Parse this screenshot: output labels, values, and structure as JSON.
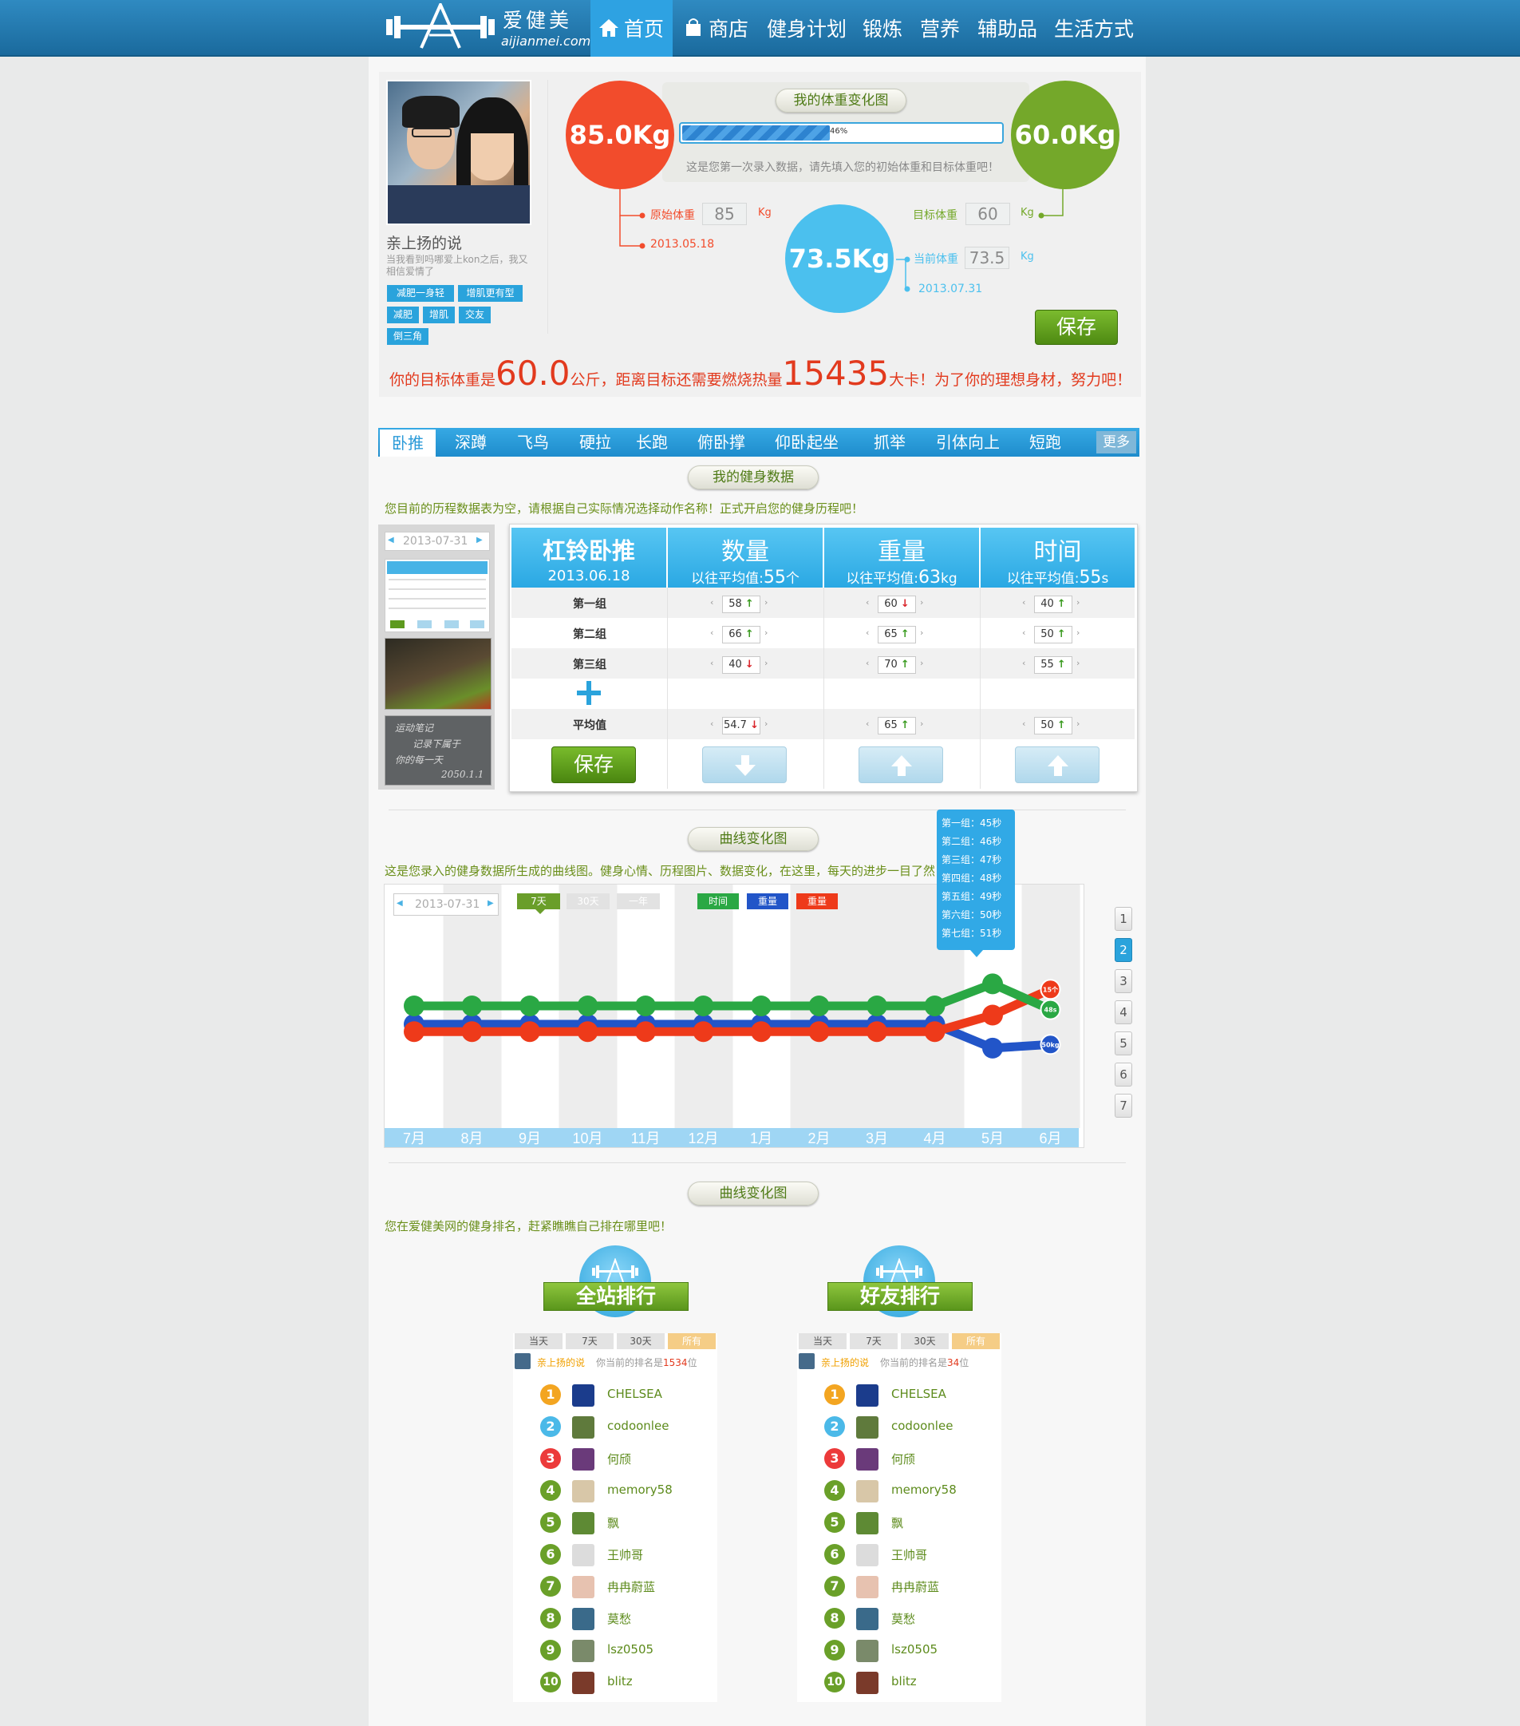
{
  "header": {
    "logo_cn": "爱健美",
    "logo_en": "aijianmei.com",
    "nav": [
      "首页",
      "商店",
      "健身计划",
      "锻炼",
      "营养",
      "辅助品",
      "生活方式"
    ],
    "active_nav": "首页"
  },
  "profile": {
    "name": "亲上扬的说",
    "bio": "当我看到吗哪爱上kon之后，我又相信爱情了",
    "tags": [
      "减肥一身轻",
      "增肌更有型",
      "减肥",
      "增肌",
      "交友",
      "倒三角"
    ]
  },
  "weight": {
    "chart_title": "我的体重变化图",
    "initial_circle": "85.0Kg",
    "target_circle": "60.0Kg",
    "current_circle": "73.5Kg",
    "progress_label": "46%",
    "progress": 0.46,
    "hint": "这是您第一次录入数据，请先填入您的初始体重和目标体重吧！",
    "initial_label": "原始体重",
    "initial_value": "85",
    "initial_date": "2013.05.18",
    "target_label": "目标体重",
    "target_value": "60",
    "current_label": "当前体重",
    "current_value": "73.5",
    "current_date": "2013.07.31",
    "unit": "Kg",
    "save_label": "保存",
    "colors": {
      "initial": "#f24c2c",
      "target": "#74a82a",
      "current": "#4bc0ee"
    }
  },
  "goal_line": {
    "p1": "你的目标体重是",
    "target": "60.0",
    "p2": "公斤，距离目标还需要燃烧热量",
    "kcal": "15435",
    "p3": "大卡！为了你的理想身材，努力吧！"
  },
  "exercise_tabs": [
    "卧推",
    "深蹲",
    "飞鸟",
    "硬拉",
    "长跑",
    "俯卧撑",
    "仰卧起坐",
    "抓举",
    "引体向上",
    "短跑"
  ],
  "exercise_more": "更多",
  "fitness": {
    "section_title": "我的健身数据",
    "hint": "您目前的历程数据表为空，请根据自己实际情况选择动作名称！正式开启您的健身历程吧！",
    "side_date": "2013-07-31",
    "note_lines": [
      "运动笔记",
      "记录下属于",
      "你的每一天"
    ],
    "note_date": "2050.1.1",
    "exercise_name": "杠铃卧推",
    "exercise_date": "2013.06.18",
    "columns": [
      {
        "title": "数量",
        "avg_label": "以往平均值:",
        "avg": "55",
        "unit": "个"
      },
      {
        "title": "重量",
        "avg_label": "以往平均值:",
        "avg": "63",
        "unit": "kg"
      },
      {
        "title": "时间",
        "avg_label": "以往平均值:",
        "avg": "55",
        "unit": "s"
      }
    ],
    "rows": [
      {
        "label": "第一组",
        "values": [
          [
            "58",
            "up"
          ],
          [
            "60",
            "down"
          ],
          [
            "40",
            "up"
          ]
        ]
      },
      {
        "label": "第二组",
        "values": [
          [
            "66",
            "up"
          ],
          [
            "65",
            "up"
          ],
          [
            "50",
            "up"
          ]
        ]
      },
      {
        "label": "第三组",
        "values": [
          [
            "40",
            "down"
          ],
          [
            "70",
            "up"
          ],
          [
            "55",
            "up"
          ]
        ]
      },
      {
        "label": "平均值",
        "values": [
          [
            "54.7",
            "down"
          ],
          [
            "65",
            "up"
          ],
          [
            "50",
            "up"
          ]
        ]
      }
    ],
    "save_label": "保存"
  },
  "curve": {
    "section_title": "曲线变化图",
    "hint": "这是您录入的健身数据所生成的曲线图。健身心情、历程图片、数据变化，在这里，每天的进步一目了然！",
    "date": "2013-07-31",
    "ranges": [
      "7天",
      "30天",
      "一年"
    ],
    "active_range": "7天",
    "legend": [
      {
        "label": "时间",
        "color": "#2aa844"
      },
      {
        "label": "重量",
        "color": "#2255c8"
      },
      {
        "label": "重量",
        "color": "#ee3a1a"
      }
    ],
    "tooltip": [
      "第一组：45秒",
      "第二组：46秒",
      "第三组：47秒",
      "第四组：48秒",
      "第五组：49秒",
      "第六组：50秒",
      "第七组：51秒"
    ],
    "end_labels": [
      "15个",
      "48s",
      "50kg"
    ],
    "pages": [
      "1",
      "2",
      "3",
      "4",
      "5",
      "6",
      "7"
    ],
    "active_page": "2"
  },
  "chart_data": {
    "type": "line",
    "categories": [
      "7月",
      "8月",
      "9月",
      "10月",
      "11月",
      "12月",
      "1月",
      "2月",
      "3月",
      "4月",
      "5月",
      "6月"
    ],
    "series": [
      {
        "color": "#2aa844",
        "values": [
          10,
          10,
          10,
          10,
          10,
          10,
          10,
          10,
          10,
          10,
          22,
          8
        ]
      },
      {
        "color": "#2255c8",
        "values": [
          0,
          0,
          0,
          0,
          0,
          0,
          0,
          0,
          0,
          0,
          -13,
          -11
        ]
      },
      {
        "color": "#ee3a1a",
        "values": [
          -4,
          -4,
          -4,
          -4,
          -4,
          -4,
          -4,
          -4,
          -4,
          -4,
          5,
          19
        ]
      }
    ],
    "grid": "alternating columns"
  },
  "ranking": {
    "section_title": "曲线变化图",
    "hint": "您在爱健美网的健身排名，赶紧瞧瞧自己排在哪里吧！",
    "boards": [
      {
        "title": "全站排行",
        "my_rank": "1534"
      },
      {
        "title": "好友排行",
        "my_rank": "34"
      }
    ],
    "tabs": [
      "当天",
      "7天",
      "30天",
      "所有"
    ],
    "active_tab": "所有",
    "me": "亲上扬的说",
    "rank_prefix": "你当前的排名是",
    "rank_suffix": "位",
    "entries": [
      {
        "n": "1",
        "name": "CHELSEA"
      },
      {
        "n": "2",
        "name": "codoonlee"
      },
      {
        "n": "3",
        "name": "何颀"
      },
      {
        "n": "4",
        "name": "memory58"
      },
      {
        "n": "5",
        "name": "飘"
      },
      {
        "n": "6",
        "name": "王帅哥"
      },
      {
        "n": "7",
        "name": "冉冉蔚蓝"
      },
      {
        "n": "8",
        "name": "莫愁"
      },
      {
        "n": "9",
        "name": "lsz0505"
      },
      {
        "n": "10",
        "name": "blitz"
      }
    ],
    "num_colors": [
      "#f3a521",
      "#4bb9e8",
      "#ec3a3a",
      "#6aa029",
      "#6aa029",
      "#6aa029",
      "#6aa029",
      "#6aa029",
      "#6aa029",
      "#6aa029"
    ]
  }
}
